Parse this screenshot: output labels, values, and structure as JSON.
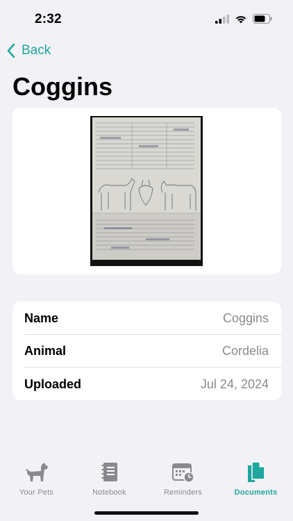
{
  "status_bar": {
    "time": "2:32"
  },
  "nav": {
    "back_label": "Back"
  },
  "page": {
    "title": "Coggins"
  },
  "document": {
    "image_alt": "Scanned Coggins certificate"
  },
  "details": [
    {
      "label": "Name",
      "value": "Coggins"
    },
    {
      "label": "Animal",
      "value": "Cordelia"
    },
    {
      "label": "Uploaded",
      "value": "Jul 24, 2024"
    }
  ],
  "tabs": [
    {
      "label": "Your Pets",
      "icon": "dog-icon",
      "active": false
    },
    {
      "label": "Notebook",
      "icon": "notebook-icon",
      "active": false
    },
    {
      "label": "Reminders",
      "icon": "calendar-clock-icon",
      "active": false
    },
    {
      "label": "Documents",
      "icon": "documents-icon",
      "active": true
    }
  ],
  "colors": {
    "accent": "#1FA79E",
    "background": "#F2F1F6",
    "secondary_text": "#8A8A8E"
  }
}
